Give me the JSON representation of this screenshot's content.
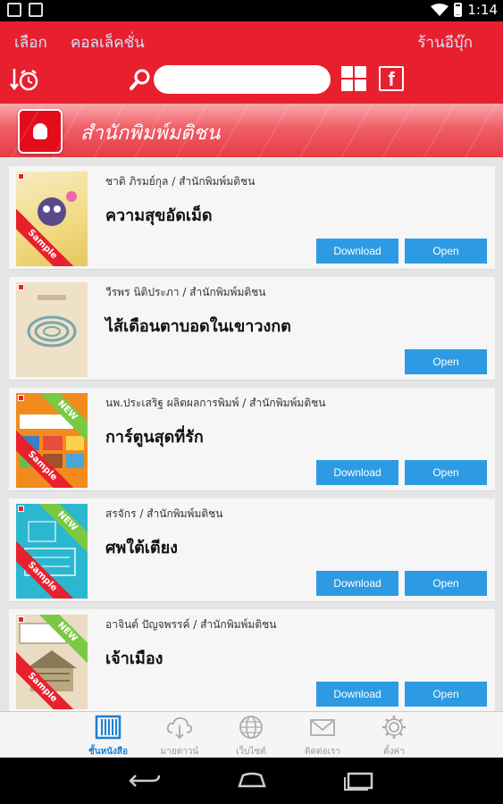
{
  "status_bar": {
    "time": "1:14"
  },
  "header": {
    "menu_left_1": "เลือก",
    "menu_left_2": "คอลเล็คชั่น",
    "menu_right": "ร้านอีบุ๊ก",
    "search_placeholder": ""
  },
  "banner": {
    "publisher_name": "สำนักพิมพ์มติชน"
  },
  "books": [
    {
      "author": "ชาติ ภิรมย์กุล / สำนักพิมพ์มติชน",
      "title": "ความสุขอัดเม็ด",
      "sample": "Sample",
      "new": "",
      "download": "Download",
      "open": "Open",
      "cover_color": "#f3e6b0"
    },
    {
      "author": "วีรพร นิติประภา / สำนักพิมพ์มติชน",
      "title": "ไส้เดือนตาบอดในเขาวงกต",
      "sample": "",
      "new": "",
      "download": "",
      "open": "Open",
      "cover_color": "#efe0c8"
    },
    {
      "author": "นพ.ประเสริฐ ผลิตผลการพิมพ์ / สำนักพิมพ์มติชน",
      "title": "การ์ตูนสุดที่รัก",
      "sample": "Sample",
      "new": "NEW",
      "download": "Download",
      "open": "Open",
      "cover_color": "#f28a1e"
    },
    {
      "author": "สรจักร / สำนักพิมพ์มติชน",
      "title": "ศพใต้เตียง",
      "sample": "Sample",
      "new": "NEW",
      "download": "Download",
      "open": "Open",
      "cover_color": "#2bb7d0"
    },
    {
      "author": "อาจินต์ ปัญจพรรค์ / สำนักพิมพ์มติชน",
      "title": "เจ้าเมือง",
      "sample": "Sample",
      "new": "NEW",
      "download": "Download",
      "open": "Open",
      "cover_color": "#e9dcc3"
    }
  ],
  "bottom_nav": [
    {
      "label": "ชั้นหนังสือ",
      "icon": "bookshelf-icon",
      "active": true
    },
    {
      "label": "มายดาวน์",
      "icon": "cloud-download-icon",
      "active": false
    },
    {
      "label": "เว็บไซต์",
      "icon": "globe-icon",
      "active": false
    },
    {
      "label": "ติดต่อเรา",
      "icon": "envelope-icon",
      "active": false
    },
    {
      "label": "ตั้งค่า",
      "icon": "gear-icon",
      "active": false
    }
  ],
  "colors": {
    "brand_red": "#e8202e",
    "button_blue": "#2d9be3",
    "active_nav": "#1e7fd4"
  }
}
